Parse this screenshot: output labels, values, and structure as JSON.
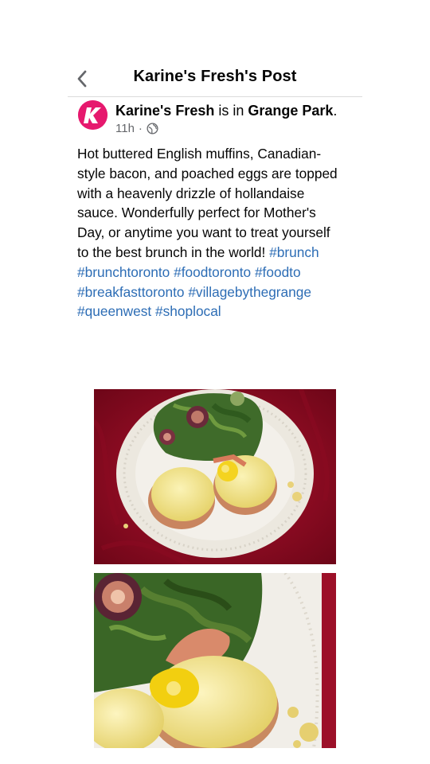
{
  "header": {
    "title": "Karine's Fresh's Post"
  },
  "post": {
    "author": "Karine's Fresh",
    "checkin_connector": " is in ",
    "location": "Grange Park",
    "location_suffix": ".",
    "timestamp": "11h",
    "separator": "·",
    "privacy_icon": "globe-icon",
    "text_lines": [
      "Hot buttered English muffins, Canadian-",
      "style bacon, and poached eggs are topped",
      "with a heavenly drizzle of hollandaise",
      "sauce. Wonderfully perfect for Mother's",
      "Day, or anytime you want to treat yourself",
      "to the best brunch in the world! "
    ],
    "hashtags": [
      "#brunch",
      "#brunchtoronto",
      "#foodtoronto",
      "#foodto",
      "#breakfasttoronto",
      "#villagebythegrange",
      "#queenwest",
      "#shoplocal"
    ],
    "photos_icon": [
      "photo-eggs-benedict-plate",
      "photo-eggs-benedict-closeup"
    ]
  },
  "colors": {
    "brand": "#e6196e",
    "link": "#2d6db5",
    "meta": "#65676b"
  }
}
